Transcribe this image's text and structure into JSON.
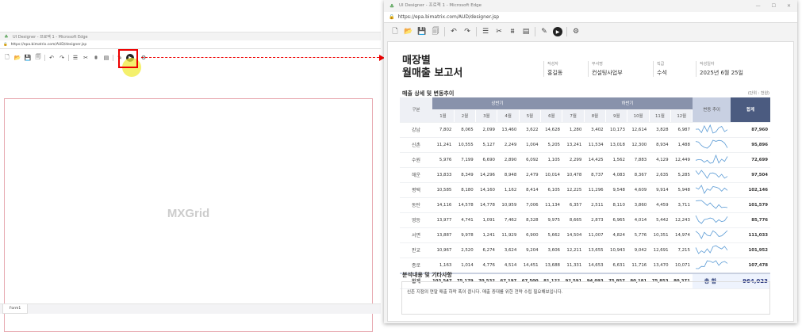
{
  "left_window": {
    "title": "UI Designer - 프로젝 1 - Microsoft Edge",
    "url": "https://epa.bimatrix.com/AUD/designer.jsp",
    "canvas_label": "MXGrid",
    "tab": "Form1"
  },
  "right_window": {
    "title": "UI Designer - 프로젝 1 - Microsoft Edge",
    "url": "https://epa.bimatrix.com/AUD/designer.jsp",
    "window_controls": [
      "—",
      "☐",
      "✕"
    ]
  },
  "toolbar": [
    {
      "icon": "new-file-icon",
      "glyph": "🗋"
    },
    {
      "icon": "open-folder-icon",
      "glyph": "📂"
    },
    {
      "icon": "save-icon",
      "glyph": "💾"
    },
    {
      "icon": "save-all-icon",
      "glyph": "🗐"
    },
    {
      "sep": true
    },
    {
      "icon": "undo-icon",
      "glyph": "↶"
    },
    {
      "icon": "redo-icon",
      "glyph": "↷"
    },
    {
      "sep": true
    },
    {
      "icon": "database-icon",
      "glyph": "☰"
    },
    {
      "icon": "tools-icon",
      "glyph": "✂"
    },
    {
      "icon": "hierarchy-icon",
      "glyph": "⩩"
    },
    {
      "icon": "code-window-icon",
      "glyph": "▤"
    },
    {
      "sep": true
    },
    {
      "icon": "edit-icon",
      "glyph": "✎"
    },
    {
      "icon": "run-preview-icon",
      "glyph": "▶"
    },
    {
      "sep": true
    },
    {
      "icon": "settings-gear-icon",
      "glyph": "⚙"
    }
  ],
  "report": {
    "title_line1": "매장별",
    "title_line2": "월매출 보고서",
    "meta": [
      {
        "label": "작성자",
        "value": "홍길동"
      },
      {
        "label": "부서명",
        "value": "컨설팅사업부"
      },
      {
        "label": "직급",
        "value": "수석"
      },
      {
        "label": "작성일자",
        "value": "2025년 6월 25일"
      }
    ],
    "section_title": "매출 상세 및 변동추이",
    "unit": "(단위 : 천원)",
    "headers": {
      "category": "구분",
      "first_half": "상반기",
      "second_half": "하반기",
      "trend": "변동 추이",
      "sum": "합계"
    },
    "months": [
      "1월",
      "2월",
      "3월",
      "4월",
      "5월",
      "6월",
      "7월",
      "8월",
      "9월",
      "10월",
      "11월",
      "12월"
    ],
    "rows": [
      {
        "name": "강남",
        "values": [
          7802,
          8065,
          2099,
          13460,
          3622,
          14628,
          1280,
          3402,
          10173,
          12614,
          3828,
          6987
        ],
        "total": "87,960"
      },
      {
        "name": "신촌",
        "values": [
          11241,
          10555,
          5127,
          2249,
          1004,
          5205,
          13241,
          11534,
          13018,
          12300,
          8934,
          1488
        ],
        "total": "95,896"
      },
      {
        "name": "수원",
        "values": [
          5976,
          7199,
          6690,
          2890,
          6092,
          1105,
          2299,
          14425,
          1562,
          7883,
          4129,
          12449
        ],
        "total": "72,699"
      },
      {
        "name": "해운",
        "values": [
          13833,
          8349,
          14296,
          8948,
          2479,
          10014,
          10478,
          8737,
          4083,
          8367,
          2635,
          5285
        ],
        "total": "97,504"
      },
      {
        "name": "평택",
        "values": [
          10585,
          8180,
          14160,
          1162,
          8414,
          6105,
          12225,
          11296,
          9548,
          4609,
          9914,
          5948
        ],
        "total": "102,146"
      },
      {
        "name": "동탄",
        "values": [
          14116,
          14578,
          14778,
          10959,
          7006,
          11134,
          6357,
          2511,
          8110,
          3860,
          4459,
          3711
        ],
        "total": "101,579"
      },
      {
        "name": "영등",
        "values": [
          13977,
          4741,
          1091,
          7462,
          8328,
          9975,
          8665,
          2873,
          6965,
          4014,
          5442,
          12243
        ],
        "total": "85,776"
      },
      {
        "name": "서면",
        "values": [
          13887,
          9978,
          1241,
          11929,
          6900,
          5662,
          14504,
          11007,
          4824,
          5776,
          10351,
          14974
        ],
        "total": "111,033"
      },
      {
        "name": "판교",
        "values": [
          10967,
          2520,
          6274,
          3624,
          9204,
          3606,
          12211,
          13655,
          10943,
          9042,
          12691,
          7215
        ],
        "total": "101,952"
      },
      {
        "name": "종로",
        "values": [
          1163,
          1014,
          4776,
          4514,
          14451,
          13688,
          11331,
          14653,
          6631,
          11716,
          13470,
          10071
        ],
        "total": "107,478"
      }
    ],
    "total_row": {
      "name": "합계",
      "values": [
        "103,547",
        "75,179",
        "70,532",
        "67,197",
        "67,500",
        "81,122",
        "92,591",
        "94,093",
        "75,857",
        "80,181",
        "75,853",
        "80,371"
      ],
      "grand_label": "총 합",
      "grand_total": "964,023"
    },
    "notes_title": "분석내용 및 기타사항",
    "notes_text": "신촌 지점의 연말 매출 하락 폭이 큽니다. 매출 증대를 위한 전략 수립 필요해보입니다."
  },
  "colors": {
    "sparkline": "#5b9bd5",
    "header": "#8892ab",
    "sum_header": "#4b5b80",
    "highlight": "#e00000"
  }
}
